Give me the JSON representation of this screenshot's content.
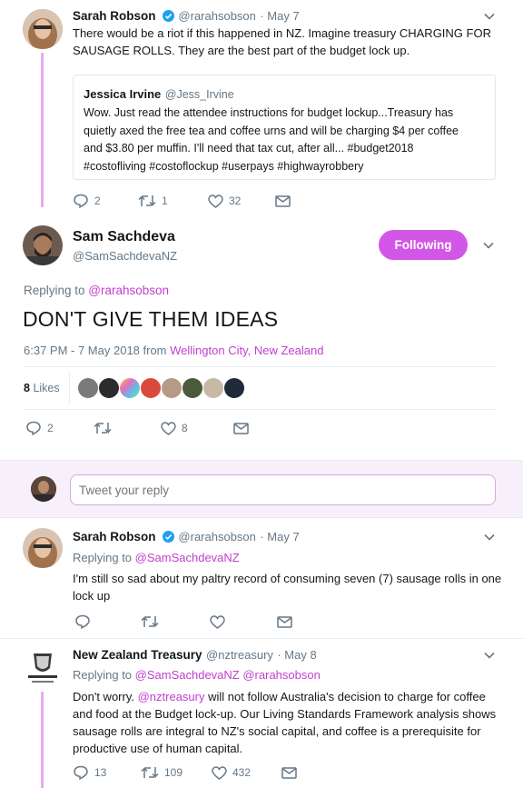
{
  "colors": {
    "accent": "#c13fcf",
    "thread": "#e9a9f0",
    "follow_bg": "#d357e6",
    "divider": "#e6ecf0",
    "gray": "#657786"
  },
  "tweet1": {
    "name": "Sarah Robson",
    "handle": "@rarahsobson",
    "date": "· May 7",
    "text_l1": "There would be a riot if this happened in NZ. Imagine treasury CHARGING FOR",
    "text_l2": "SAUSAGE ROLLS. They are the best part of the budget lock up.",
    "quote": {
      "name": "Jessica Irvine",
      "handle": "@Jess_Irvine",
      "l1": "Wow. Just read the attendee instructions for budget lockup...Treasury has",
      "l2": "quietly axed the free tea and coffee urns and will be charging $4 per coffee",
      "l3": "and $3.80 per muffin. I'll need that tax cut, after all... #budget2018",
      "l4": "#costofliving #costoflockup #userpays #highwayrobbery"
    },
    "replies": "2",
    "retweets": "1",
    "likes": "32"
  },
  "main": {
    "name": "Sam Sachdeva",
    "handle": "@SamSachdevaNZ",
    "follow_label": "Following",
    "replying_prefix": "Replying to ",
    "replying_to": "@rarahsobson",
    "text": "DON'T GIVE THEM IDEAS",
    "time": "6:37 PM - 7 May 2018 from ",
    "location": "Wellington City, New Zealand",
    "likes_count": "8",
    "likes_label": "Likes",
    "replies": "2",
    "retweets": "",
    "likes": "8"
  },
  "reply_box": {
    "placeholder": "Tweet your reply"
  },
  "tweet2": {
    "name": "Sarah Robson",
    "handle": "@rarahsobson",
    "date": "· May 7",
    "replying_prefix": "Replying to ",
    "replying_to": "@SamSachdevaNZ",
    "l1": "I'm still so sad about my paltry record of consuming seven (7) sausage rolls in one",
    "l2": "lock up"
  },
  "tweet3": {
    "name": "New Zealand Treasury",
    "handle": "@nztreasury",
    "date": "· May 8",
    "replying_prefix": "Replying to ",
    "replying_to1": "@SamSachdevaNZ",
    "replying_to2": "@rarahsobson",
    "l1_pre": "Don't worry. ",
    "l1_link": "@nztreasury",
    "l1_post": " will not follow Australia's decision to charge for coffee",
    "l2": "and food at the Budget lock-up. Our Living Standards Framework analysis shows",
    "l3": "sausage rolls are integral to NZ's social capital, and coffee is a prerequisite for",
    "l4": "productive use of human capital.",
    "replies": "13",
    "retweets": "109",
    "likes": "432"
  }
}
